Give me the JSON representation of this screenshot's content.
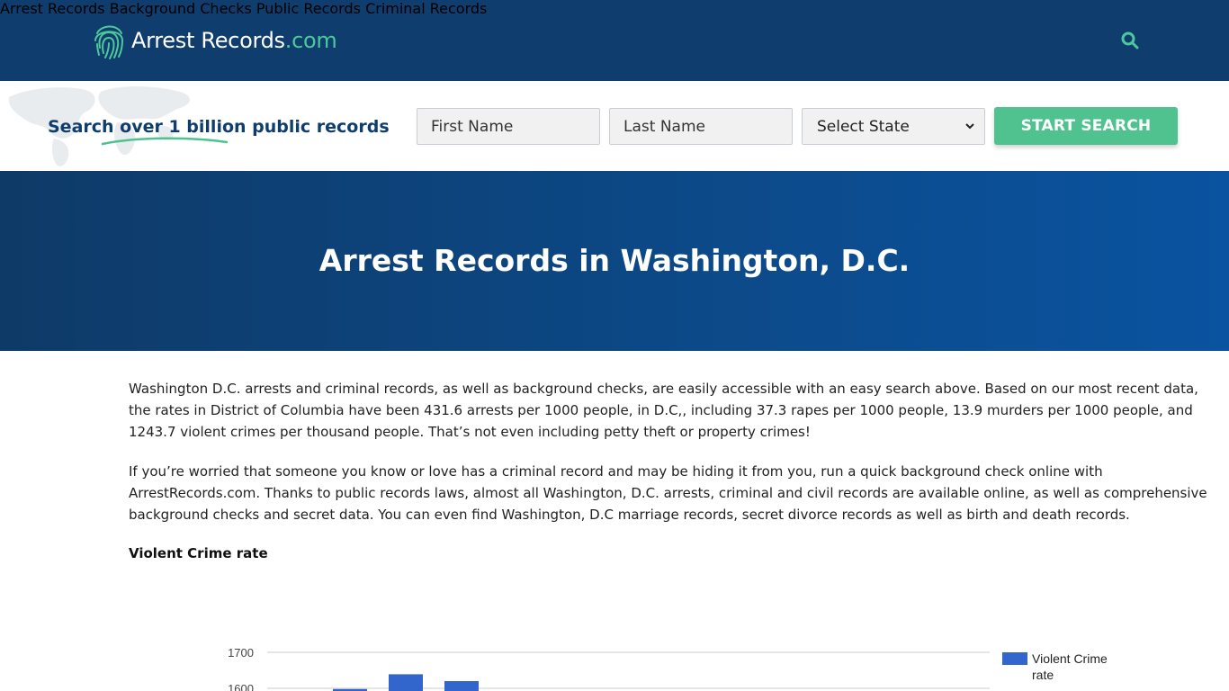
{
  "header": {
    "logo_main": "Arrest Records",
    "logo_tld": ".com",
    "nav": [
      "Arrest Records",
      "Background Checks",
      "Public Records",
      "Criminal Records"
    ],
    "search_icon": "search-icon"
  },
  "searchbar": {
    "tagline": "Search over 1 billion public records",
    "first_name_placeholder": "First Name",
    "last_name_placeholder": "Last Name",
    "state_selected": "Select State",
    "button_label": "START SEARCH"
  },
  "hero": {
    "title": "Arrest Records in Washington, D.C."
  },
  "content": {
    "p1": [
      "Washington D.C.  arrests and criminal records, as well as background checks, are easily accessible with an easy search above. Based on our most recent data,",
      "the rates in District of Columbia have been 431.6 arrests per 1000 people, in D.C,, including 37.3 rapes per 1000 people, 13.9 murders per 1000 people, and",
      "1243.7 violent crimes per thousand people. That’s not even including petty theft or property crimes!"
    ],
    "p2": [
      "If you’re worried that someone you know or love has a criminal record and may be hiding it from you, run a quick background check online with",
      "ArrestRecords.com. Thanks to public records laws, almost all Washington, D.C. arrests, criminal and civil records are available online, as well as comprehensive",
      "background checks and secret data. You can even find Washington, D.C  marriage records, secret divorce records as well as birth and death records."
    ],
    "chart_heading": "Violent Crime rate"
  },
  "colors": {
    "header_bg": "#0f3d6e",
    "accent_green": "#4fc28f",
    "bar_blue": "#3366cc"
  },
  "chart_data": {
    "type": "bar",
    "series": [
      {
        "name": "Violent Crime rate",
        "values": [
          1598,
          1639,
          1620
        ]
      }
    ],
    "y_ticks": [
      "1700",
      "1600"
    ],
    "legend_label_lines": [
      "Violent Crime",
      "rate"
    ],
    "ylim_visible": [
      1600,
      1700
    ],
    "grid": true,
    "legend_position": "right"
  }
}
